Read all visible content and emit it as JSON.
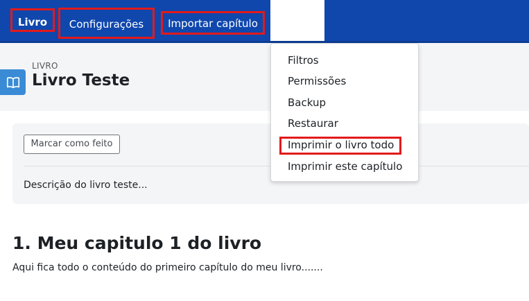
{
  "nav": {
    "tabs": [
      "Livro",
      "Configurações",
      "Importar capítulo"
    ]
  },
  "header": {
    "kicker": "LIVRO",
    "title": "Livro Teste",
    "icon": "book-icon"
  },
  "card": {
    "mark_done_label": "Marcar como feito",
    "description": "Descrição do livro teste..."
  },
  "chapter": {
    "title": "1. Meu capitulo 1 do livro",
    "body": "Aqui fica todo o conteúdo do primeiro capítulo do meu livro......."
  },
  "dropdown": {
    "items": [
      "Filtros",
      "Permissões",
      "Backup",
      "Restaurar",
      "Imprimir o livro todo",
      "Imprimir este capítulo"
    ]
  },
  "colors": {
    "nav_bg": "#0f47ad",
    "highlight": "#e31a1a",
    "book_badge": "#3a8bd6"
  }
}
